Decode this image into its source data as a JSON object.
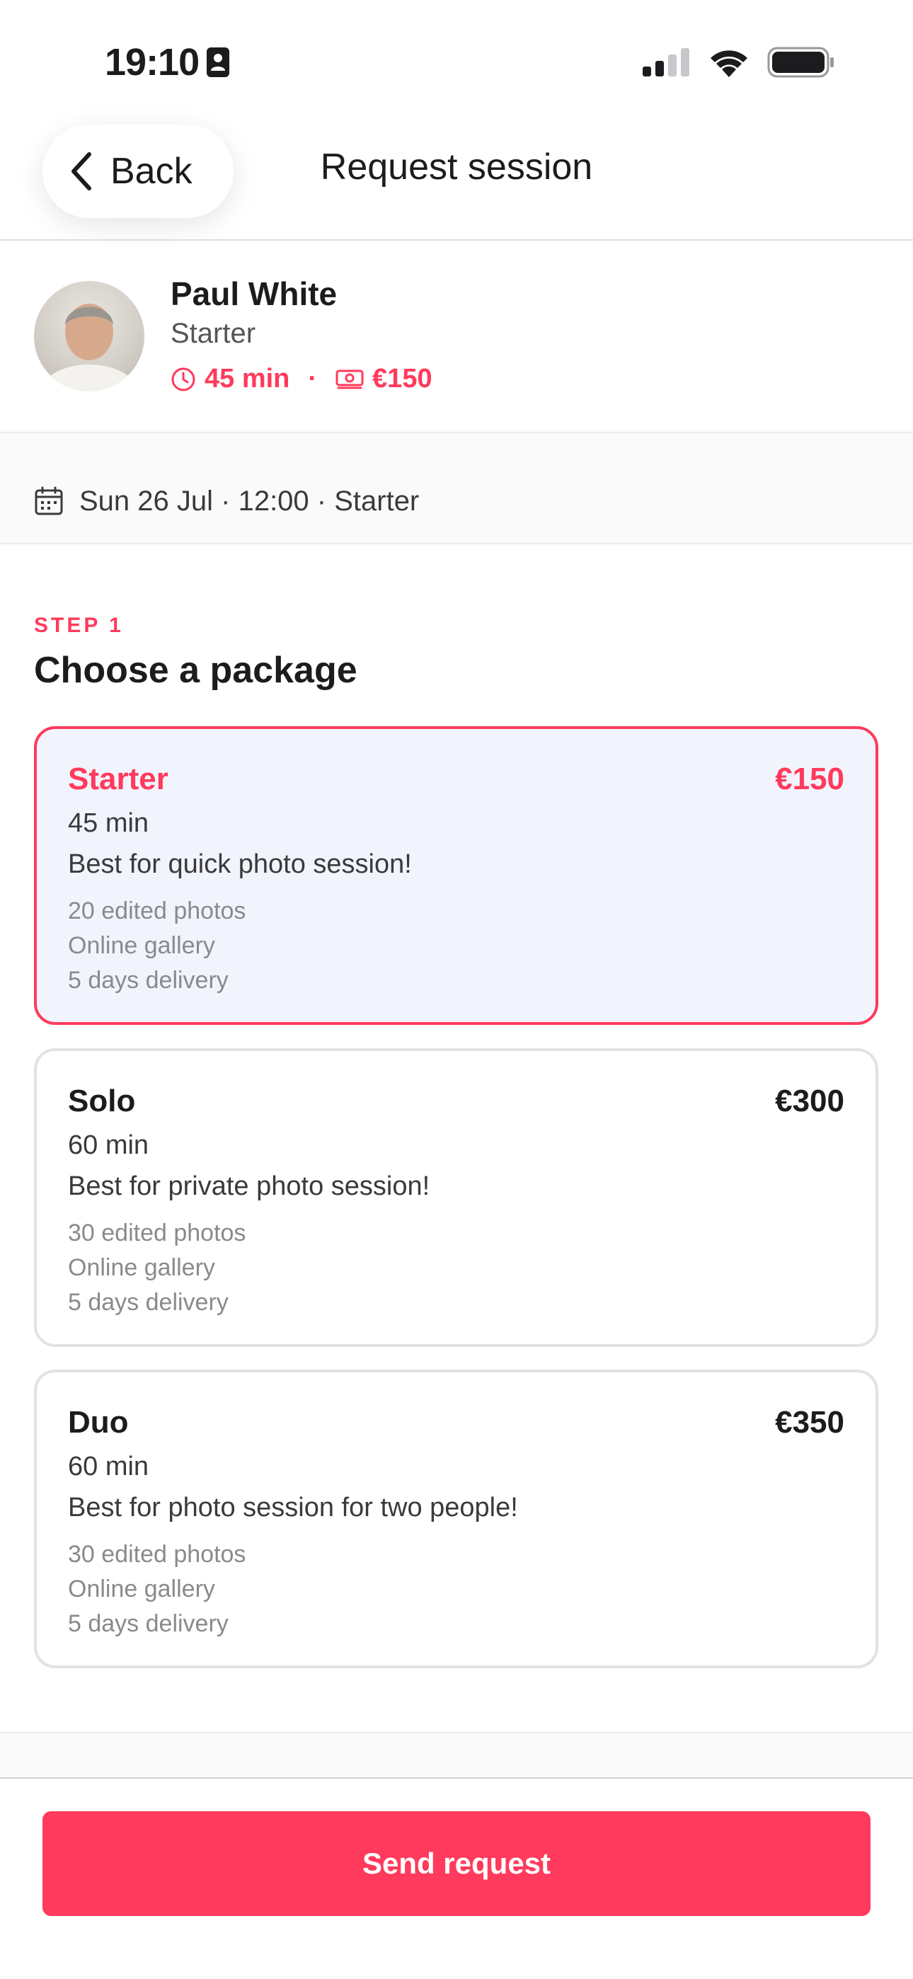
{
  "status_bar": {
    "time": "19:10",
    "icons": [
      "contact-card-icon",
      "cellular-signal-icon",
      "wifi-icon",
      "battery-icon"
    ]
  },
  "nav": {
    "back_label": "Back",
    "title": "Request session"
  },
  "photographer": {
    "name": "Paul White",
    "package": "Starter",
    "duration": "45 min",
    "separator": "·",
    "price": "€150"
  },
  "booking": {
    "summary": "Sun 26 Jul · 12:00 · Starter"
  },
  "step": {
    "label": "STEP 1",
    "title": "Choose a package"
  },
  "packages": [
    {
      "name": "Starter",
      "price": "€150",
      "duration": "45 min",
      "description": "Best for quick photo session!",
      "features": [
        "20 edited photos",
        "Online gallery",
        "5 days delivery"
      ],
      "selected": true
    },
    {
      "name": "Solo",
      "price": "€300",
      "duration": "60 min",
      "description": "Best for private photo session!",
      "features": [
        "30 edited photos",
        "Online gallery",
        "5 days delivery"
      ],
      "selected": false
    },
    {
      "name": "Duo",
      "price": "€350",
      "duration": "60 min",
      "description": "Best for photo session for two people!",
      "features": [
        "30 edited photos",
        "Online gallery",
        "5 days delivery"
      ],
      "selected": false
    }
  ],
  "cta": {
    "send_label": "Send request"
  },
  "colors": {
    "accent": "#ff3a5c",
    "selected_card_bg": "#f2f4fd",
    "text_primary": "#1c1c1e",
    "text_muted": "#8a8a8e"
  }
}
